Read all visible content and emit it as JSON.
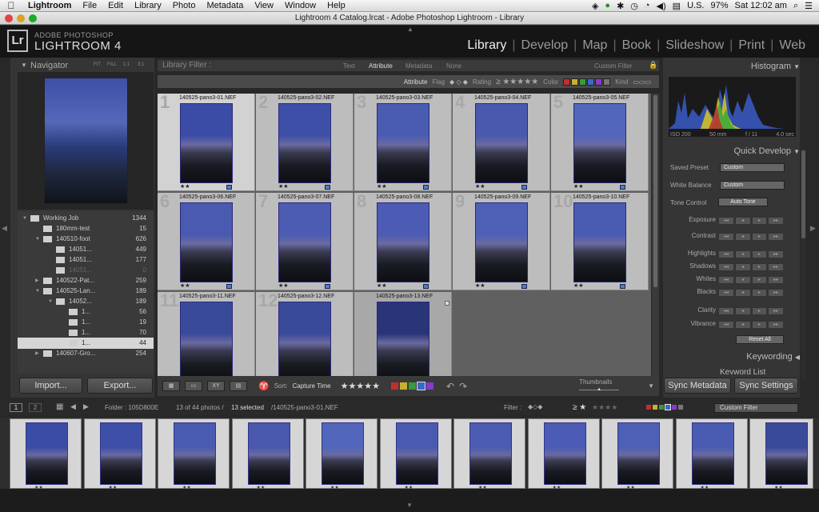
{
  "menubar": {
    "app": "Lightroom",
    "items": [
      "File",
      "Edit",
      "Library",
      "Photo",
      "Metadata",
      "View",
      "Window",
      "Help"
    ],
    "locale": "U.S.",
    "battery": "97%",
    "clock": "Sat 12:02 am"
  },
  "window": {
    "title": "Lightroom 4 Catalog.lrcat - Adobe Photoshop Lightroom - Library"
  },
  "identity": {
    "badge": "Lr",
    "line1": "ADOBE PHOTOSHOP",
    "line2": "LIGHTROOM 4",
    "modules": [
      "Library",
      "Develop",
      "Map",
      "Book",
      "Slideshow",
      "Print",
      "Web"
    ],
    "active": "Library"
  },
  "navigator": {
    "title": "Navigator",
    "zoom": [
      "FIT",
      "FILL",
      "1:1",
      "3:1"
    ]
  },
  "folders": [
    {
      "name": "Working Job",
      "count": "1344",
      "indent": 0,
      "state": "open"
    },
    {
      "name": "180mm-test",
      "count": "15",
      "indent": 1,
      "state": "none"
    },
    {
      "name": "140510-foot",
      "count": "626",
      "indent": 1,
      "state": "open"
    },
    {
      "name": "14051...",
      "count": "449",
      "indent": 2,
      "state": "none"
    },
    {
      "name": "14051...",
      "count": "177",
      "indent": 2,
      "state": "none"
    },
    {
      "name": "14051...",
      "count": "0",
      "indent": 2,
      "state": "dim"
    },
    {
      "name": "140522-Pat...",
      "count": "259",
      "indent": 1,
      "state": "closed"
    },
    {
      "name": "140525-Lan...",
      "count": "189",
      "indent": 1,
      "state": "open"
    },
    {
      "name": "14052...",
      "count": "189",
      "indent": 2,
      "state": "open"
    },
    {
      "name": "1...",
      "count": "56",
      "indent": 3,
      "state": "none"
    },
    {
      "name": "1...",
      "count": "19",
      "indent": 3,
      "state": "none"
    },
    {
      "name": "1...",
      "count": "70",
      "indent": 3,
      "state": "none"
    },
    {
      "name": "1...",
      "count": "44",
      "indent": 3,
      "state": "selected"
    },
    {
      "name": "140607-Gro...",
      "count": "254",
      "indent": 1,
      "state": "closed"
    }
  ],
  "left_buttons": {
    "import": "Import...",
    "export": "Export..."
  },
  "filter": {
    "label": "Library Filter :",
    "tabs": [
      "Text",
      "Attribute",
      "Metadata",
      "None"
    ],
    "active_tab": "Attribute",
    "preset": "Custom Filter",
    "attribute_label": "Attribute",
    "flag_label": "Flag",
    "rating_label": "Rating",
    "color_label": "Color",
    "kind_label": "Kind",
    "colors": [
      "#c03030",
      "#c8b030",
      "#3a9a3a",
      "#3a6ac8",
      "#8a3ac8",
      "#777777"
    ]
  },
  "grid": {
    "photos": [
      {
        "num": "1",
        "name": "140525-pano3-01.NEF",
        "stars": "★★",
        "selected": true,
        "sky": "#3a4ca6"
      },
      {
        "num": "2",
        "name": "140525-pano3-02.NEF",
        "stars": "★★",
        "selected": false,
        "sky": "#3e4fa8"
      },
      {
        "num": "3",
        "name": "140525-pano3-03.NEF",
        "stars": "★★",
        "selected": false,
        "sky": "#4a5cb2"
      },
      {
        "num": "4",
        "name": "140525-pano3-04.NEF",
        "stars": "★★",
        "selected": false,
        "sky": "#4a58ae"
      },
      {
        "num": "5",
        "name": "140525-pano3-05.NEF",
        "stars": "★★",
        "selected": false,
        "sky": "#5266bc"
      },
      {
        "num": "6",
        "name": "140525-pano3-06.NEF",
        "stars": "★★",
        "selected": false,
        "sky": "#4a5ab0"
      },
      {
        "num": "7",
        "name": "140525-pano3-07.NEF",
        "stars": "★★",
        "selected": false,
        "sky": "#4c5cb2"
      },
      {
        "num": "8",
        "name": "140525-pano3-08.NEF",
        "stars": "★★",
        "selected": false,
        "sky": "#4c5cb4"
      },
      {
        "num": "9",
        "name": "140525-pano3-09.NEF",
        "stars": "★★",
        "selected": false,
        "sky": "#4e60b6"
      },
      {
        "num": "10",
        "name": "140525-pano3-10.NEF",
        "stars": "★★",
        "selected": false,
        "sky": "#4a5cb2"
      },
      {
        "num": "11",
        "name": "140525-pano3-11.NEF",
        "stars": "",
        "selected": false,
        "sky": "#3a4a9a"
      },
      {
        "num": "12",
        "name": "140525-pano3-12.NEF",
        "stars": "",
        "selected": false,
        "sky": "#3a4a9a"
      },
      {
        "num": "13",
        "name": "140525-pano3-13.NEF",
        "stars": "",
        "selected": false,
        "sky": "#2a3478"
      }
    ]
  },
  "toolbar": {
    "sort_label": "Sort:",
    "sort_value": "Capture Time",
    "stars": "★★★★★",
    "thumbnails_label": "Thumbnails"
  },
  "histogram": {
    "title": "Histogram",
    "iso": "ISO 200",
    "focal": "50 mm",
    "aperture": "f / 11",
    "shutter": "4.0 sec"
  },
  "quickdevelop": {
    "title": "Quick Develop",
    "saved_preset_label": "Saved Preset",
    "saved_preset_value": "Custom",
    "wb_label": "White Balance",
    "wb_value": "Custom",
    "tone_label": "Tone Control",
    "auto_tone": "Auto Tone",
    "sliders": [
      "Exposure",
      "Contrast",
      "Highlights",
      "Shadows",
      "Whites",
      "Blacks",
      "Clarity",
      "Vibrance"
    ],
    "reset": "Reset All"
  },
  "right_panels": {
    "keywording": "Keywording",
    "keyword_list": "Keyword List"
  },
  "right_buttons": {
    "sync_metadata": "Sync Metadata",
    "sync_settings": "Sync Settings"
  },
  "filmstrip": {
    "page1": "1",
    "page2": "2",
    "folder": "Folder : 105D800E",
    "count": "13 of 44 photos /",
    "selected_count": "13 selected",
    "selected_file": "/140525-pano3-01.NEF",
    "filter_label": "Filter :",
    "filter_rating": "≥ ★",
    "custom_filter": "Custom Filter",
    "thumbs": [
      {
        "stars": "★★",
        "sky": "#3a4ca6"
      },
      {
        "stars": "★★",
        "sky": "#3e4fa8"
      },
      {
        "stars": "★★",
        "sky": "#4a5cb2"
      },
      {
        "stars": "★★",
        "sky": "#4a58ae"
      },
      {
        "stars": "★★",
        "sky": "#5266bc"
      },
      {
        "stars": "★★",
        "sky": "#4a5ab0"
      },
      {
        "stars": "★★",
        "sky": "#4c5cb2"
      },
      {
        "stars": "★★",
        "sky": "#4c5cb4"
      },
      {
        "stars": "★★",
        "sky": "#4e60b6"
      },
      {
        "stars": "★★",
        "sky": "#4a5cb2"
      },
      {
        "stars": "★★",
        "sky": "#3a4a9a"
      }
    ]
  }
}
